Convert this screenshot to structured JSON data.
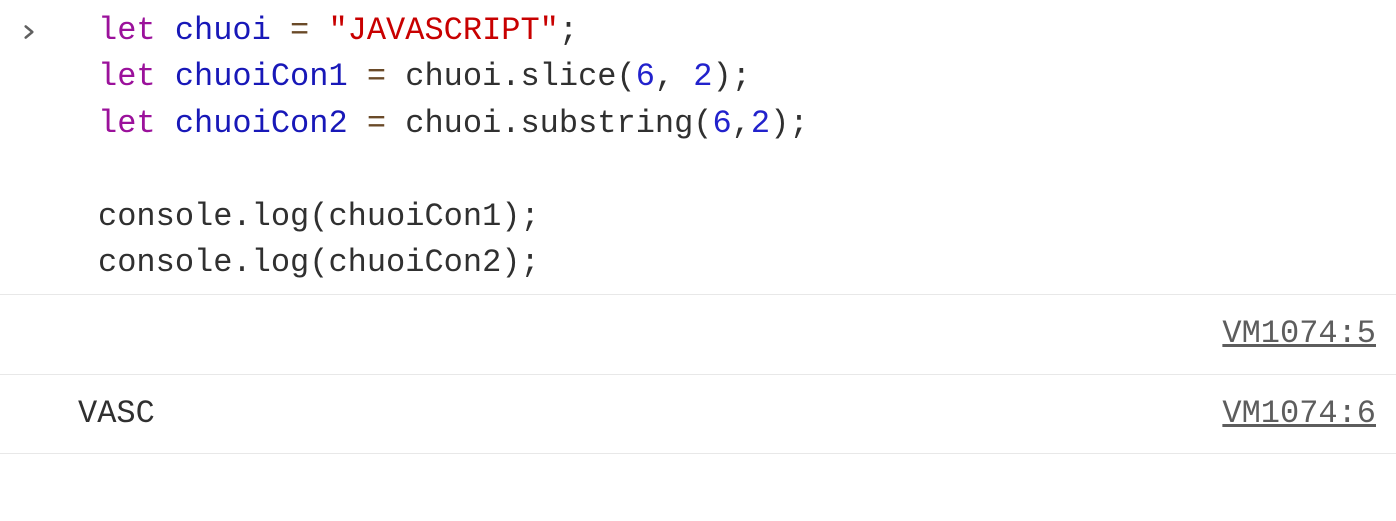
{
  "input": {
    "line1": {
      "kw": "let",
      "name": "chuoi",
      "op": "=",
      "str": "\"JAVASCRIPT\"",
      "end": ";"
    },
    "line2": {
      "kw": "let",
      "name": "chuoiCon1",
      "op": "=",
      "obj": "chuoi",
      "dot": ".",
      "fn": "slice",
      "open": "(",
      "arg1": "6",
      "comma": ", ",
      "arg2": "2",
      "close": ");"
    },
    "line3": {
      "kw": "let",
      "name": "chuoiCon2",
      "op": "=",
      "obj": "chuoi",
      "dot": ".",
      "fn": "substring",
      "open": "(",
      "arg1": "6",
      "comma": ",",
      "arg2": "2",
      "close": ");"
    },
    "line5": {
      "obj": "console",
      "dot": ".",
      "fn": "log",
      "open": "(",
      "arg": "chuoiCon1",
      "close": ");"
    },
    "line6": {
      "obj": "console",
      "dot": ".",
      "fn": "log",
      "open": "(",
      "arg": "chuoiCon2",
      "close": ");"
    }
  },
  "outputs": [
    {
      "text": "",
      "source": "VM1074:5"
    },
    {
      "text": "VASC",
      "source": "VM1074:6"
    }
  ]
}
